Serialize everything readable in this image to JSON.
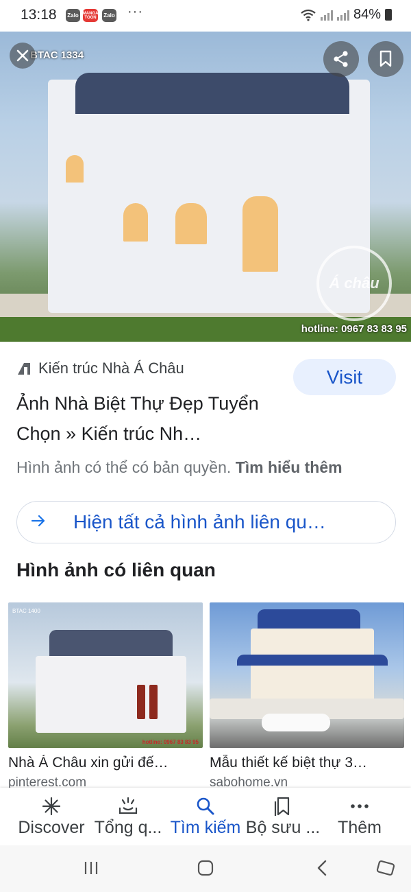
{
  "status_bar": {
    "time": "13:18",
    "apps": [
      "Zalo",
      "MANGA TOON",
      "Zalo"
    ],
    "more": "···",
    "battery": "84%"
  },
  "hero": {
    "tag_text": "BTAC 1334",
    "hotline_text": "hotline: 0967 83 83 95",
    "logo_text": "Á châu",
    "icons": {
      "close": "close-icon",
      "share": "share-icon",
      "bookmark": "bookmark-icon"
    }
  },
  "result": {
    "source_name": "Kiến trúc Nhà Á Châu",
    "visit_label": "Visit",
    "title": "Ảnh Nhà Biệt Thự Đẹp Tuyển Chọn » Kiến trúc Nh…",
    "copyright_text": "Hình ảnh có thể có bản quyền.",
    "learn_more": "Tìm hiểu thêm",
    "show_all_label": "Hiện tất cả hình ảnh liên qu…"
  },
  "related": {
    "section_title": "Hình ảnh có liên quan",
    "items": [
      {
        "tag": "BTAC 1400",
        "caption": "Nhà Á Châu xin gửi đế…",
        "source": "pinterest.com",
        "hotline": "hotline: 0967 83 83 95"
      },
      {
        "caption": "Mẫu thiết kế biệt thự 3…",
        "source": "sabohome.vn"
      }
    ]
  },
  "bottom_nav": [
    {
      "label": "Discover",
      "icon": "asterisk-icon"
    },
    {
      "label": "Tổng q...",
      "icon": "snapshot-icon"
    },
    {
      "label": "Tìm kiếm",
      "icon": "search-icon",
      "active": true
    },
    {
      "label": "Bộ sưu ...",
      "icon": "collections-icon"
    },
    {
      "label": "Thêm",
      "icon": "more-icon"
    }
  ],
  "colors": {
    "accent": "#1a56c9",
    "visit_bg": "#e8f0fe",
    "text_secondary": "#70757a"
  }
}
